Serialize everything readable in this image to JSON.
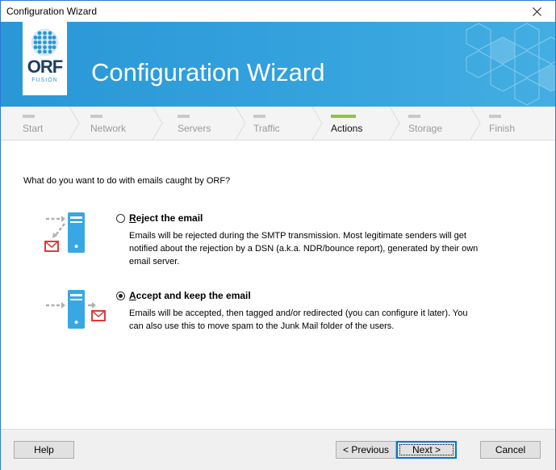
{
  "window": {
    "title": "Configuration Wizard"
  },
  "banner": {
    "heading": "Configuration Wizard",
    "logo_text": "ORF",
    "logo_subtext": "FUSION",
    "colors": {
      "banner": "#2a97d6",
      "logo_text": "#1e3d62"
    }
  },
  "steps": [
    {
      "label": "Start",
      "active": false
    },
    {
      "label": "Network",
      "active": false
    },
    {
      "label": "Servers",
      "active": false
    },
    {
      "label": "Traffic",
      "active": false
    },
    {
      "label": "Actions",
      "active": true
    },
    {
      "label": "Storage",
      "active": false
    },
    {
      "label": "Finish",
      "active": false
    }
  ],
  "main": {
    "question": "What do you want to do with emails caught by ORF?",
    "options": [
      {
        "title": "Reject the email",
        "description": "Emails will be rejected during the SMTP transmission. Most legitimate senders will get notified about the rejection by a DSN (a.k.a. NDR/bounce report), generated by their own email server.",
        "checked": false,
        "icon": "server-reject-icon"
      },
      {
        "title": "Accept and keep the email",
        "description": "Emails will be accepted, then tagged and/or redirected (you can configure it later). You can also use this to move spam to the Junk Mail folder of the users.",
        "checked": true,
        "icon": "server-accept-icon"
      }
    ]
  },
  "buttons": {
    "help": "Help",
    "previous": "< Previous",
    "next": "Next >",
    "cancel": "Cancel"
  },
  "accent_colors": {
    "active_step": "#8cc63f",
    "server_icon": "#39a7e3",
    "mail_icon": "#e03a3a"
  }
}
